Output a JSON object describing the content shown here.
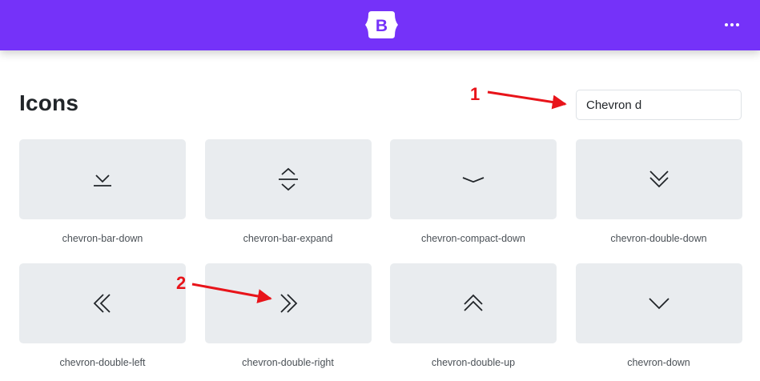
{
  "header": {
    "logo_letter": "B",
    "brand_color": "#7532f9",
    "more_icon": "three-dots-icon"
  },
  "page": {
    "title": "Icons"
  },
  "search": {
    "value": "Chevron d"
  },
  "icons": [
    {
      "label": "chevron-bar-down",
      "icon": "chevron-bar-down-icon"
    },
    {
      "label": "chevron-bar-expand",
      "icon": "chevron-bar-expand-icon"
    },
    {
      "label": "chevron-compact-down",
      "icon": "chevron-compact-down-icon"
    },
    {
      "label": "chevron-double-down",
      "icon": "chevron-double-down-icon"
    },
    {
      "label": "chevron-double-left",
      "icon": "chevron-double-left-icon"
    },
    {
      "label": "chevron-double-right",
      "icon": "chevron-double-right-icon"
    },
    {
      "label": "chevron-double-up",
      "icon": "chevron-double-up-icon"
    },
    {
      "label": "chevron-down",
      "icon": "chevron-down-icon"
    }
  ],
  "annotations": {
    "marker_1": "1",
    "marker_2": "2",
    "arrow_color": "#e8141a"
  }
}
